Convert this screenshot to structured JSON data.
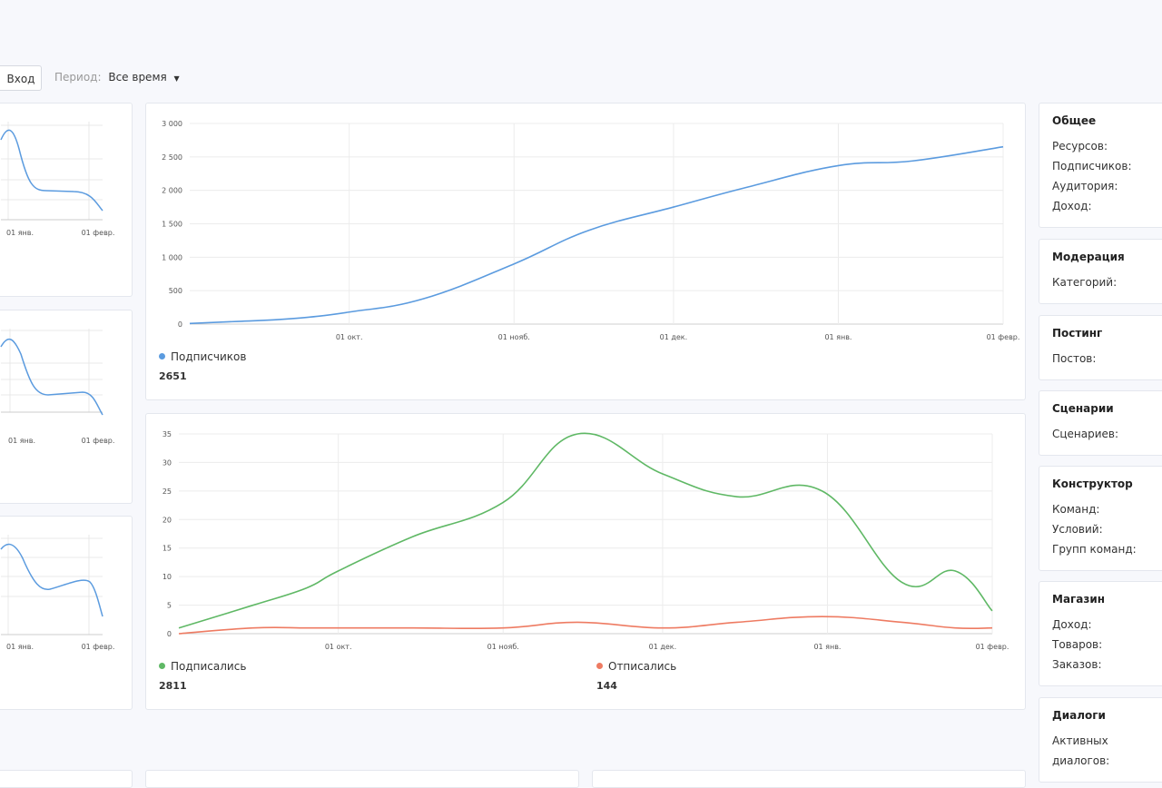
{
  "toolbar": {
    "login_label": "Вход",
    "period_label": "Период:",
    "period_value": "Все время"
  },
  "colors": {
    "blue": "#5b9bdf",
    "green": "#5fb865",
    "red": "#ee7b62"
  },
  "mini_charts": [
    {
      "x_ticks": [
        "01 янв.",
        "01 февр."
      ]
    },
    {
      "x_ticks": [
        "01 янв.",
        "01 февр."
      ]
    },
    {
      "x_ticks": [
        "01 янв.",
        "01 февр."
      ]
    }
  ],
  "chart_data": [
    {
      "type": "line",
      "x": [
        "2023-09-01",
        "2023-09-10",
        "2023-09-20",
        "2023-10-01",
        "2023-10-15",
        "2023-11-01",
        "2023-11-15",
        "2023-12-01",
        "2023-12-15",
        "2024-01-01",
        "2024-01-15",
        "2024-02-01"
      ],
      "x_ticks": [
        "01 окт.",
        "01 нояб.",
        "01 дек.",
        "01 янв.",
        "01 февр."
      ],
      "ylim": [
        0,
        3000
      ],
      "y_ticks": [
        "0",
        "500",
        "1 000",
        "1 500",
        "2 000",
        "2 500",
        "3 000"
      ],
      "series": [
        {
          "name": "Подписчиков",
          "total": "2651",
          "values": [
            10,
            40,
            80,
            180,
            380,
            900,
            1400,
            1750,
            2050,
            2370,
            2440,
            2651
          ]
        }
      ],
      "grid": true
    },
    {
      "type": "line",
      "x": [
        "2023-09-01",
        "2023-09-15",
        "2023-09-25",
        "2023-10-01",
        "2023-10-15",
        "2023-11-01",
        "2023-11-15",
        "2023-12-01",
        "2023-12-15",
        "2023-12-31",
        "2024-01-15",
        "2024-01-25",
        "2024-02-01"
      ],
      "x_ticks": [
        "01 окт.",
        "01 нояб.",
        "01 дек.",
        "01 янв.",
        "01 февр."
      ],
      "ylim": [
        0,
        35
      ],
      "y_ticks": [
        "0",
        "5",
        "10",
        "15",
        "20",
        "25",
        "30",
        "35"
      ],
      "series": [
        {
          "name": "Подписались",
          "total": "2811",
          "values": [
            1,
            5,
            8,
            11,
            17,
            23,
            35,
            28,
            24,
            25,
            9,
            11,
            4
          ]
        },
        {
          "name": "Отписались",
          "total": "144",
          "values": [
            0,
            1,
            1,
            1,
            1,
            1,
            2,
            1,
            2,
            3,
            2,
            1,
            1
          ]
        }
      ],
      "grid": true
    }
  ],
  "side_panels": [
    {
      "title": "Общее",
      "rows": [
        "Ресурсов:",
        "Подписчиков:",
        "Аудитория:",
        "Доход:"
      ]
    },
    {
      "title": "Модерация",
      "rows": [
        "Категорий:"
      ]
    },
    {
      "title": "Постинг",
      "rows": [
        "Постов:"
      ]
    },
    {
      "title": "Сценарии",
      "rows": [
        "Сценариев:"
      ]
    },
    {
      "title": "Конструктор",
      "rows": [
        "Команд:",
        "Условий:",
        "Групп команд:"
      ]
    },
    {
      "title": "Магазин",
      "rows": [
        "Доход:",
        "Товаров:",
        "Заказов:"
      ]
    },
    {
      "title": "Диалоги",
      "rows": [
        "Активных диалогов:"
      ]
    }
  ]
}
